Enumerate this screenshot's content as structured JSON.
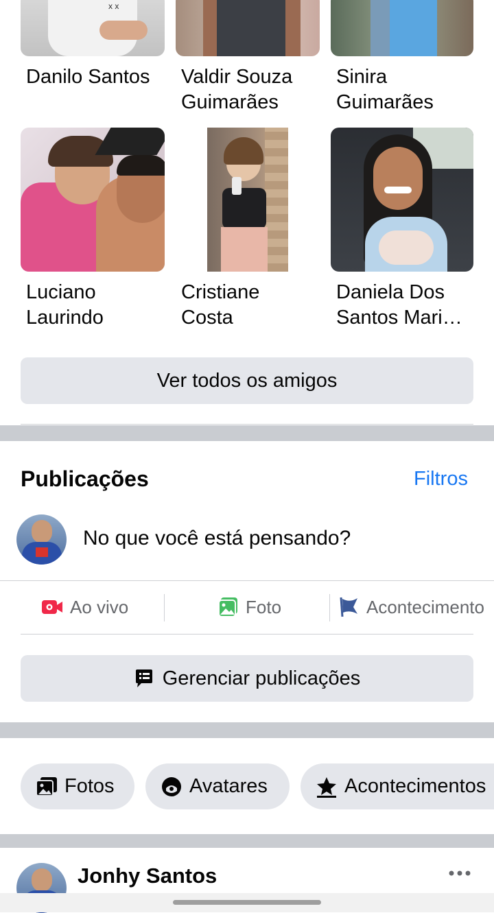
{
  "friends": [
    {
      "name": "Danilo Santos"
    },
    {
      "name": "Valdir Souza Guimarães"
    },
    {
      "name": "Sinira Guimarães"
    },
    {
      "name": "Luciano Laurindo"
    },
    {
      "name": "Cristiane Costa"
    },
    {
      "name": "Daniela Dos Santos Mari…"
    }
  ],
  "see_all_friends": "Ver todos os amigos",
  "posts": {
    "title": "Publicações",
    "filters": "Filtros",
    "composer_placeholder": "No que você está pensando?",
    "actions": {
      "live": "Ao vivo",
      "photo": "Foto",
      "event": "Acontecimento"
    },
    "manage": "Gerenciar publicações"
  },
  "chips": {
    "photos": "Fotos",
    "avatars": "Avatares",
    "events": "Acontecimentos"
  },
  "post_author": "Jonhy Santos",
  "colors": {
    "accent": "#1877f2",
    "live": "#f02849",
    "photo": "#45bd62",
    "event": "#3b5998",
    "gray_button": "#e4e6eb"
  }
}
